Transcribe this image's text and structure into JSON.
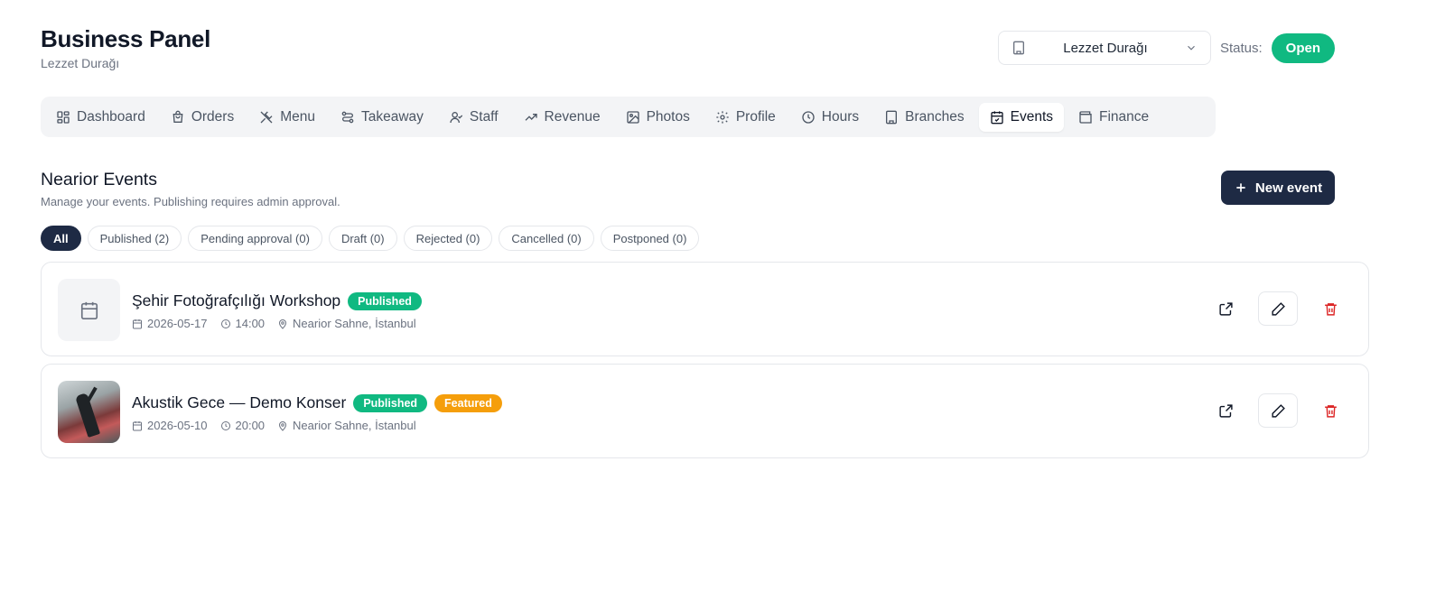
{
  "header": {
    "title": "Business Panel",
    "subtitle": "Lezzet Durağı"
  },
  "branch_select": {
    "value": "Lezzet Durağı"
  },
  "status": {
    "label": "Status:",
    "value": "Open"
  },
  "tabs": [
    {
      "label": "Dashboard",
      "icon": "dashboard-icon"
    },
    {
      "label": "Orders",
      "icon": "shopping-bag-icon"
    },
    {
      "label": "Menu",
      "icon": "utensils-icon"
    },
    {
      "label": "Takeaway",
      "icon": "route-icon"
    },
    {
      "label": "Staff",
      "icon": "user-check-icon"
    },
    {
      "label": "Revenue",
      "icon": "trending-up-icon"
    },
    {
      "label": "Photos",
      "icon": "image-icon"
    },
    {
      "label": "Profile",
      "icon": "gear-icon"
    },
    {
      "label": "Hours",
      "icon": "clock-icon"
    },
    {
      "label": "Branches",
      "icon": "building-icon"
    },
    {
      "label": "Events",
      "icon": "calendar-check-icon",
      "active": true
    },
    {
      "label": "Finance",
      "icon": "wallet-icon"
    }
  ],
  "section": {
    "title": "Nearior Events",
    "description": "Manage your events. Publishing requires admin approval.",
    "new_button": "New event"
  },
  "filters": [
    "All",
    "Published (2)",
    "Pending approval (0)",
    "Draft (0)",
    "Rejected (0)",
    "Cancelled (0)",
    "Postponed (0)"
  ],
  "events": [
    {
      "name": "Şehir Fotoğrafçılığı Workshop",
      "badges": [
        "Published"
      ],
      "date": "2026-05-17",
      "time": "14:00",
      "location": "Nearior Sahne, İstanbul",
      "thumbnail": "calendar-icon"
    },
    {
      "name": "Akustik Gece — Demo Konser",
      "badges": [
        "Published",
        "Featured"
      ],
      "date": "2026-05-10",
      "time": "20:00",
      "location": "Nearior Sahne, İstanbul",
      "thumbnail": "concert-photo"
    }
  ],
  "colors": {
    "primary": "#1e2a44",
    "success": "#10b981",
    "warning": "#f59e0b",
    "danger": "#dc2626"
  }
}
